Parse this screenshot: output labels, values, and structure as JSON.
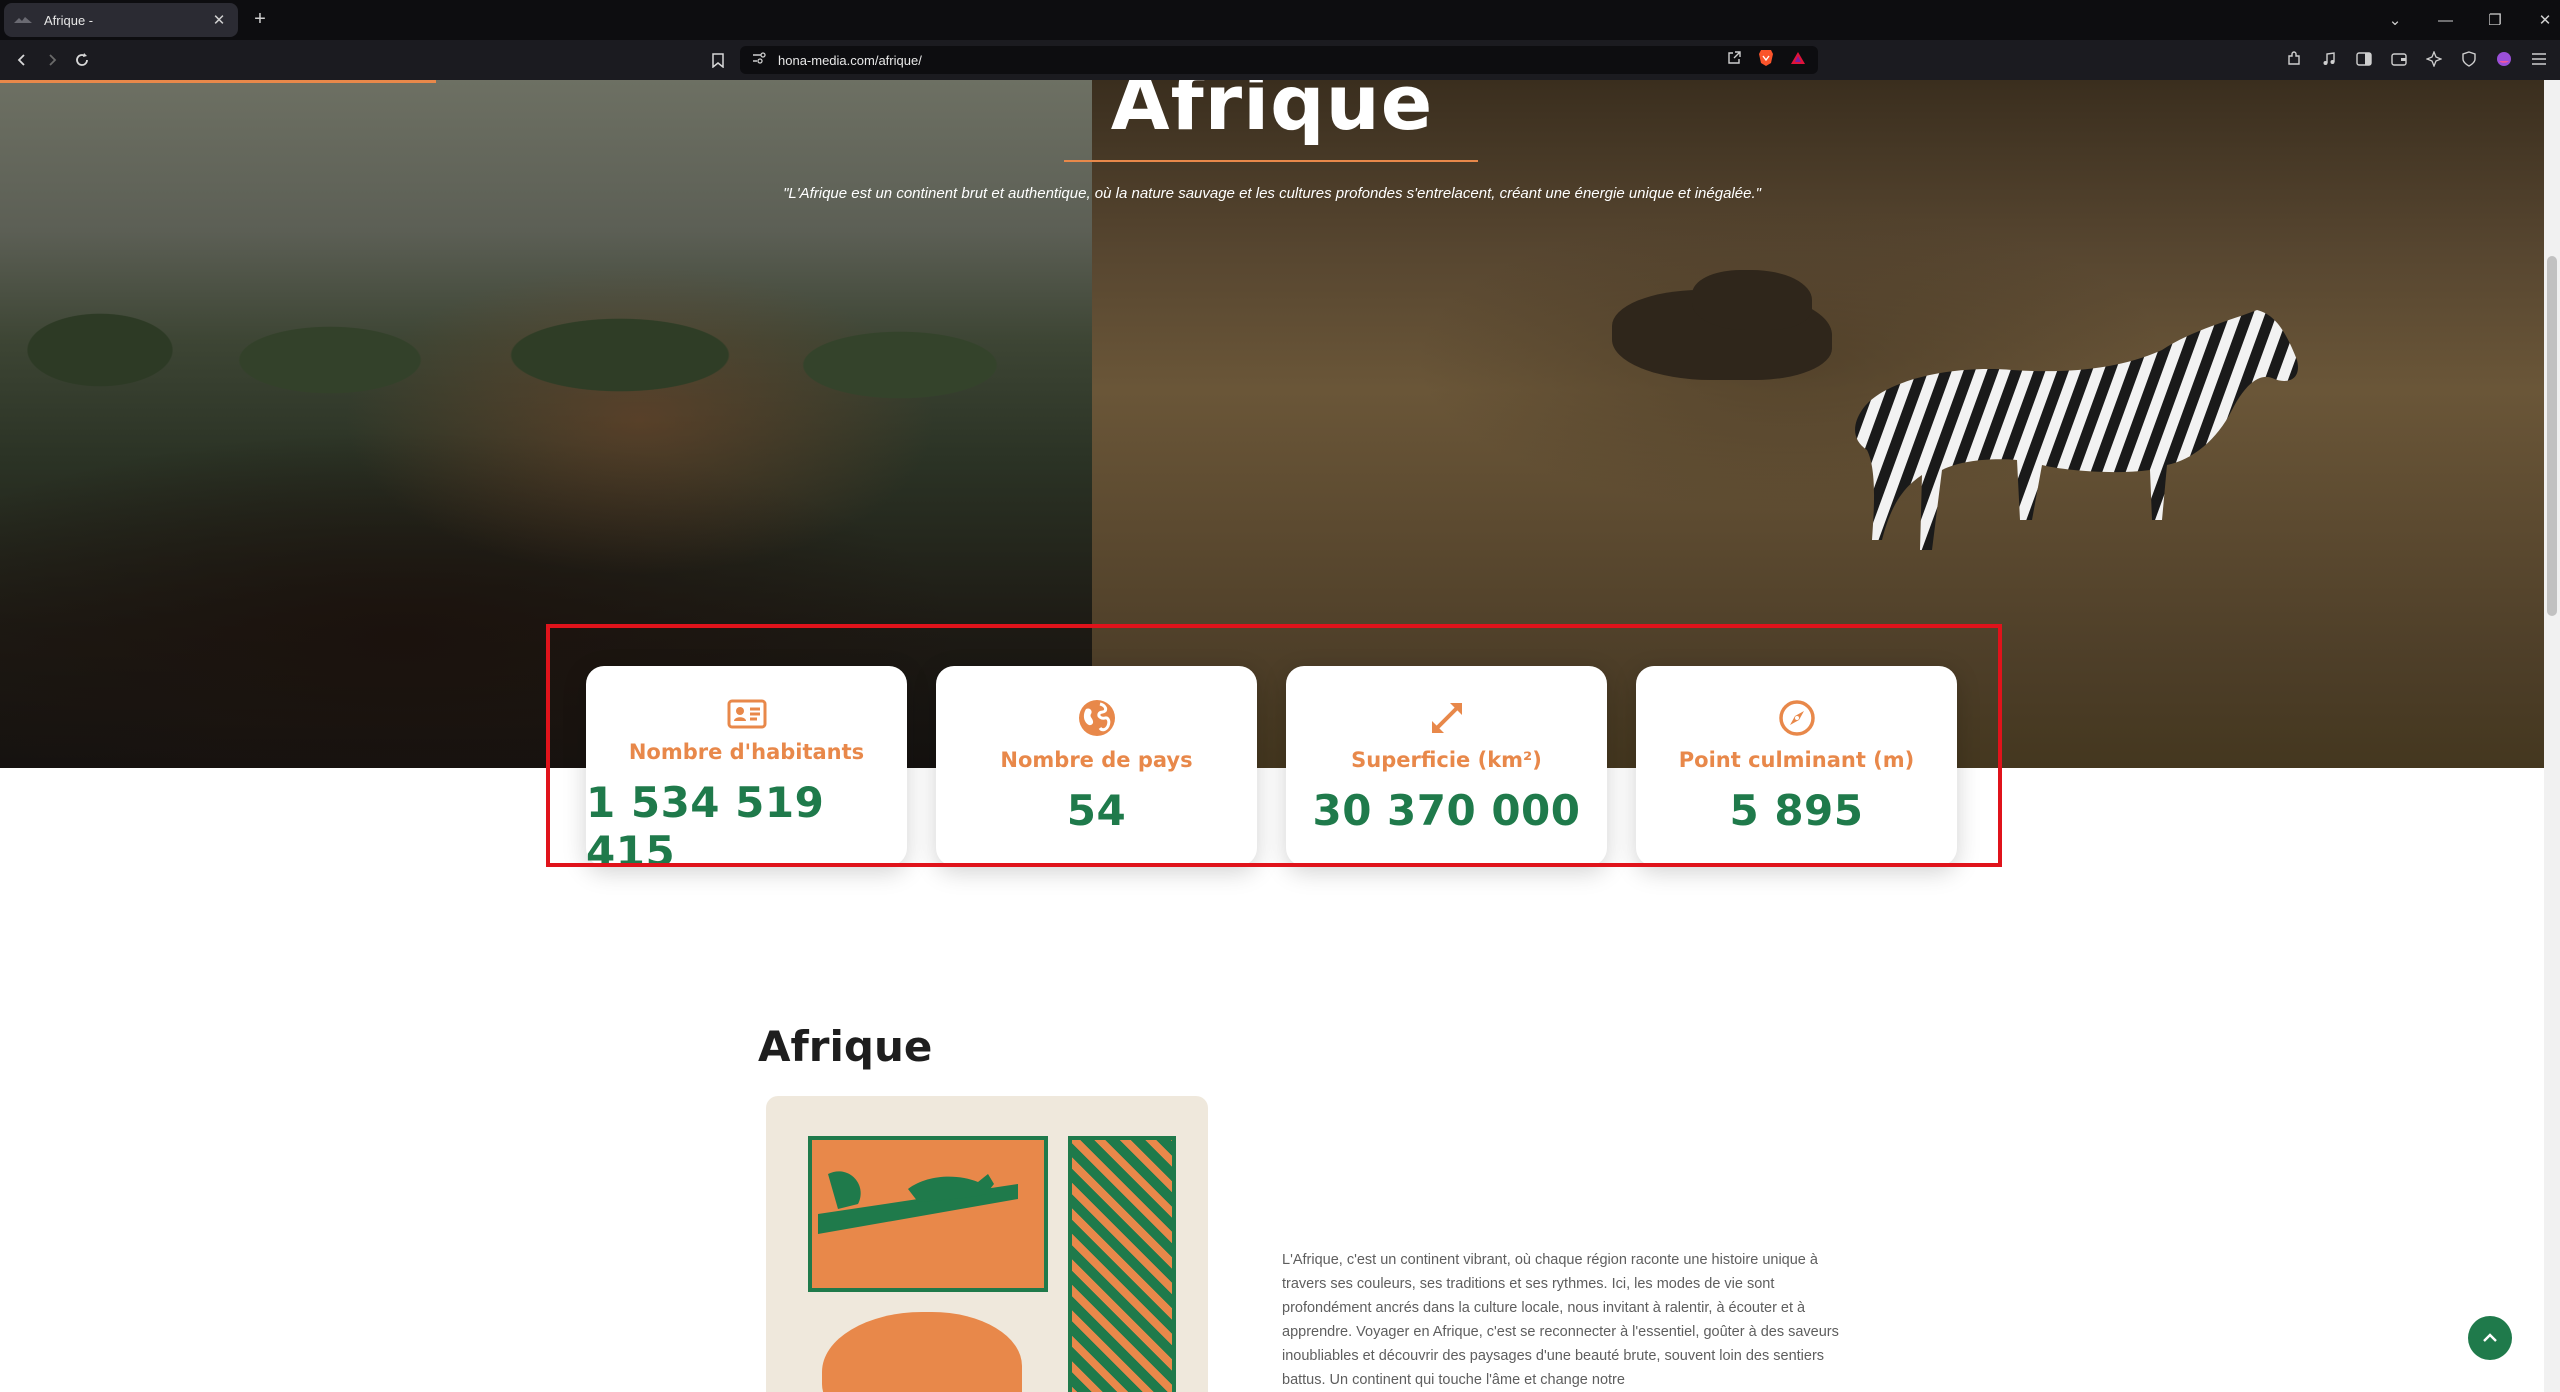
{
  "browser": {
    "tab_title": "Afrique -",
    "tab_close": "✕",
    "new_tab": "+",
    "url": "hona-media.com/afrique/",
    "window_controls": [
      "⌄",
      "—",
      "❐",
      "✕"
    ]
  },
  "hero": {
    "title": "Afrique",
    "quote": "\"L'Afrique est un continent brut et authentique, où la nature sauvage et les cultures profondes s'entrelacent, créant une énergie unique et inégalée.\""
  },
  "stats": [
    {
      "icon": "id-card-icon",
      "label": "Nombre d'habitants",
      "value": "1 534 519 415"
    },
    {
      "icon": "globe-icon",
      "label": "Nombre de pays",
      "value": "54"
    },
    {
      "icon": "expand-arrows-icon",
      "label": "Superficie (km²)",
      "value": "30 370 000"
    },
    {
      "icon": "compass-icon",
      "label": "Point culminant (m)",
      "value": "5 895"
    }
  ],
  "section": {
    "title": "Afrique",
    "paragraph": "L'Afrique, c'est un continent vibrant, où chaque région raconte une histoire unique à travers ses couleurs, ses traditions et ses rythmes. Ici, les modes de vie sont profondément ancrés dans la culture locale, nous invitant à ralentir, à écouter et à apprendre. Voyager en Afrique, c'est se reconnecter à l'essentiel, goûter à des saveurs inoubliables et découvrir des paysages d'une beauté brute, souvent loin des sentiers battus. Un continent qui touche l'âme et change notre"
  },
  "colors": {
    "accent_orange": "#e8884a",
    "accent_green": "#1f7a4b",
    "highlight_red": "#e0131b"
  }
}
